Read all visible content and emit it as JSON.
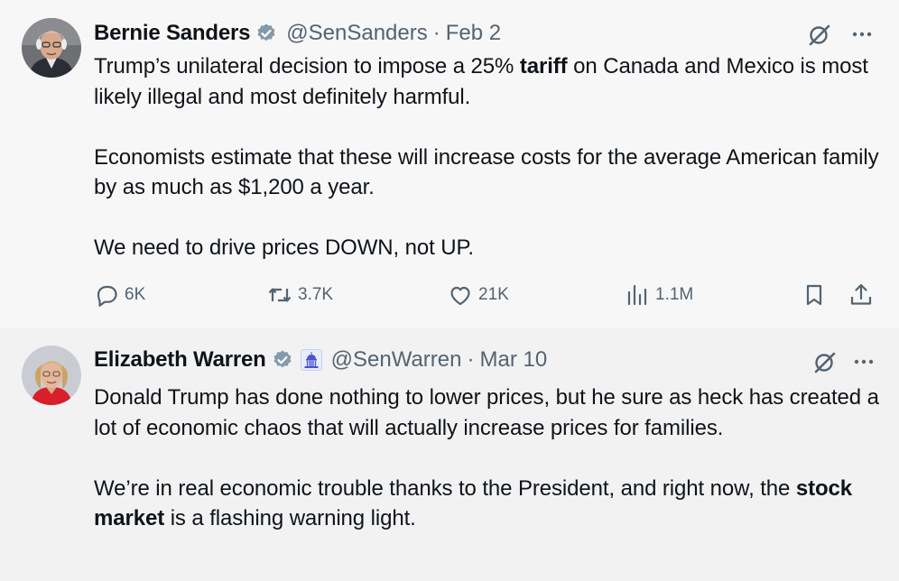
{
  "tweets": [
    {
      "author_name": "Bernie Sanders",
      "handle": "@SenSanders",
      "separator": "·",
      "date": "Feb 2",
      "body": {
        "p1_pre": "Trump’s unilateral decision to impose a 25% ",
        "p1_bold": "tariff",
        "p1_post": " on Canada and Mexico is most likely illegal and most definitely harmful.",
        "p2": "Economists estimate that these will increase costs for the average American family by as much as $1,200 a year.",
        "p3": "We need to drive prices DOWN, not UP."
      },
      "stats": {
        "replies": "6K",
        "reposts": "3.7K",
        "likes": "21K",
        "views": "1.1M"
      },
      "icons": [
        "verified-badge-icon",
        "grok-icon",
        "more-icon",
        "reply-icon",
        "repost-icon",
        "like-icon",
        "views-icon",
        "bookmark-icon",
        "share-icon"
      ]
    },
    {
      "author_name": "Elizabeth Warren",
      "handle": "@SenWarren",
      "separator": "·",
      "date": "Mar 10",
      "body": {
        "p1": "Donald Trump has done nothing to lower prices, but he sure as heck has created a lot of economic chaos that will actually increase prices for families.",
        "p2_pre": "We’re in real economic trouble thanks to the President, and right now, the ",
        "p2_bold": "stock market",
        "p2_post": " is a flashing warning light."
      },
      "icons": [
        "verified-badge-icon",
        "capitol-affiliation-icon",
        "grok-icon",
        "more-icon"
      ]
    }
  ],
  "colors": {
    "text": "#0f1419",
    "secondary": "#536471",
    "verified_badge": "#829aab",
    "tweet1_bg": "#f7f7f8",
    "tweet2_bg": "#f2f2f3"
  }
}
